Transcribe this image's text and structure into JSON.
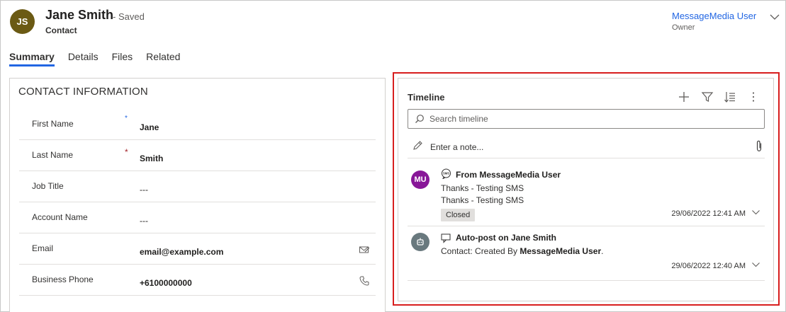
{
  "header": {
    "avatar_initials": "JS",
    "avatar_color": "#6b5a14",
    "record_name": "Jane Smith",
    "save_status": "- Saved",
    "entity_type": "Contact",
    "owner_name": "MessageMedia User",
    "owner_label": "Owner"
  },
  "tabs": [
    {
      "label": "Summary",
      "active": true
    },
    {
      "label": "Details",
      "active": false
    },
    {
      "label": "Files",
      "active": false
    },
    {
      "label": "Related",
      "active": false
    }
  ],
  "contact_info": {
    "title": "CONTACT INFORMATION",
    "fields": [
      {
        "label": "First Name",
        "required_marker": "*",
        "value": "Jane"
      },
      {
        "label": "Last Name",
        "required_marker": "*",
        "value": "Smith"
      },
      {
        "label": "Job Title",
        "value": "---"
      },
      {
        "label": "Account Name",
        "value": "---"
      },
      {
        "label": "Email",
        "value": "email@example.com",
        "icon": "email-compose-icon"
      },
      {
        "label": "Business Phone",
        "value": "+6100000000",
        "icon": "phone-icon"
      }
    ]
  },
  "timeline": {
    "title": "Timeline",
    "search_placeholder": "Search timeline",
    "note_placeholder": "Enter a note...",
    "tools": [
      "add-icon",
      "filter-icon",
      "sort-icon",
      "more-icon"
    ],
    "items": [
      {
        "avatar_initials": "MU",
        "avatar_color": "#881798",
        "type_icon": "sms-icon",
        "title": "From MessageMedia User",
        "lines": [
          "Thanks - Testing SMS",
          "Thanks - Testing SMS"
        ],
        "badge": "Closed",
        "timestamp": "29/06/2022 12:41 AM"
      },
      {
        "avatar_color": "#69797e",
        "avatar_icon": "system-robot-icon",
        "type_icon": "auto-post-icon",
        "title": "Auto-post on Jane Smith",
        "line_prefix": "Contact: Created By ",
        "line_bold": "MessageMedia User",
        "line_suffix": ".",
        "timestamp": "29/06/2022 12:40 AM"
      }
    ]
  },
  "colors": {
    "accent": "#2266e3",
    "highlight_border": "#d81e1e",
    "required": "#a4262c"
  }
}
